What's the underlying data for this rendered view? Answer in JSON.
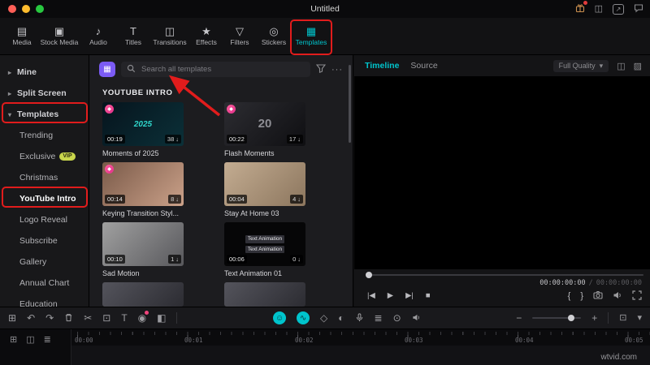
{
  "colors": {
    "accent_teal": "#00c4cc",
    "annotation_red": "#e11c1c",
    "premium_pink": "#ef4b8b",
    "purple_button": "#7b5bf5",
    "vip_badge": "#c9d64c"
  },
  "titlebar": {
    "title": "Untitled",
    "icons": {
      "layout": "◫",
      "export": "↗"
    }
  },
  "ribbon": {
    "tabs": [
      {
        "label": "Media",
        "icon": "▤"
      },
      {
        "label": "Stock Media",
        "icon": "▣"
      },
      {
        "label": "Audio",
        "icon": "♪"
      },
      {
        "label": "Titles",
        "icon": "T"
      },
      {
        "label": "Transitions",
        "icon": "◫"
      },
      {
        "label": "Effects",
        "icon": "★"
      },
      {
        "label": "Filters",
        "icon": "▽"
      },
      {
        "label": "Stickers",
        "icon": "◎"
      },
      {
        "label": "Templates",
        "icon": "▦"
      }
    ]
  },
  "sidebar": {
    "items": [
      {
        "label": "Mine",
        "chevron": "▸"
      },
      {
        "label": "Split Screen",
        "chevron": "▸"
      },
      {
        "label": "Templates",
        "chevron": "▾"
      },
      {
        "label": "Trending"
      },
      {
        "label": "Exclusive",
        "badge": "VIP"
      },
      {
        "label": "Christmas"
      },
      {
        "label": "YouTube Intro"
      },
      {
        "label": "Logo Reveal"
      },
      {
        "label": "Subscribe"
      },
      {
        "label": "Gallery"
      },
      {
        "label": "Annual Chart"
      },
      {
        "label": "Education"
      }
    ]
  },
  "library": {
    "search_placeholder": "Search all templates",
    "more_label": "···",
    "section_title": "YOUTUBE INTRO",
    "pro_badge_glyph": "◆",
    "download_glyph": "↓",
    "cards": [
      {
        "title": "Moments of 2025",
        "duration": "00:19",
        "downloads": "38",
        "thumb_text": "2025"
      },
      {
        "title": "Flash Moments",
        "duration": "00:22",
        "downloads": "17",
        "thumb_text": "20"
      },
      {
        "title": "Keying Transition Styl...",
        "duration": "00:14",
        "downloads": "8",
        "thumb_text": ""
      },
      {
        "title": "Stay At Home 03",
        "duration": "00:04",
        "downloads": "4",
        "thumb_text": ""
      },
      {
        "title": "Sad Motion",
        "duration": "00:10",
        "downloads": "1",
        "thumb_text": ""
      },
      {
        "title": "Text Animation 01",
        "duration": "00:06",
        "downloads": "0",
        "thumb_text": "Text Animation"
      }
    ]
  },
  "preview": {
    "tab_timeline": "Timeline",
    "tab_source": "Source",
    "quality": "Full Quality",
    "quality_arrow": "▾",
    "icons": {
      "panel_layout": "◫",
      "display": "▨"
    },
    "current_time": "00:00:00:00",
    "separator": "/",
    "total_time": "00:00:00:00",
    "transport": {
      "prev_frame": "|◀",
      "play": "▶",
      "next_frame": "▶|",
      "stop": "■",
      "mark_in": "{",
      "mark_out": "}"
    }
  },
  "editbar": {
    "icons": {
      "apps": "⊞",
      "undo": "↶",
      "redo": "↷",
      "scissors": "✂",
      "crop": "⊡",
      "text": "T",
      "record": "◉",
      "chroma": "◧",
      "ai_face": "☺",
      "ai_wave": "∿",
      "keyframe": "◇",
      "mask": "◐",
      "mixer": "≣",
      "screen_record": "⊙",
      "zoom_out": "−",
      "zoom_in": "+",
      "fit": "⊡",
      "collapse": "▾"
    }
  },
  "timeline": {
    "gutter_icons": {
      "tracks": "⊞",
      "magnet": "◫",
      "link": "≣"
    },
    "ruler_labels": [
      "00:00",
      "00:01",
      "00:02",
      "00:03",
      "00:04",
      "00:05"
    ]
  },
  "watermark": "wtvid.com"
}
